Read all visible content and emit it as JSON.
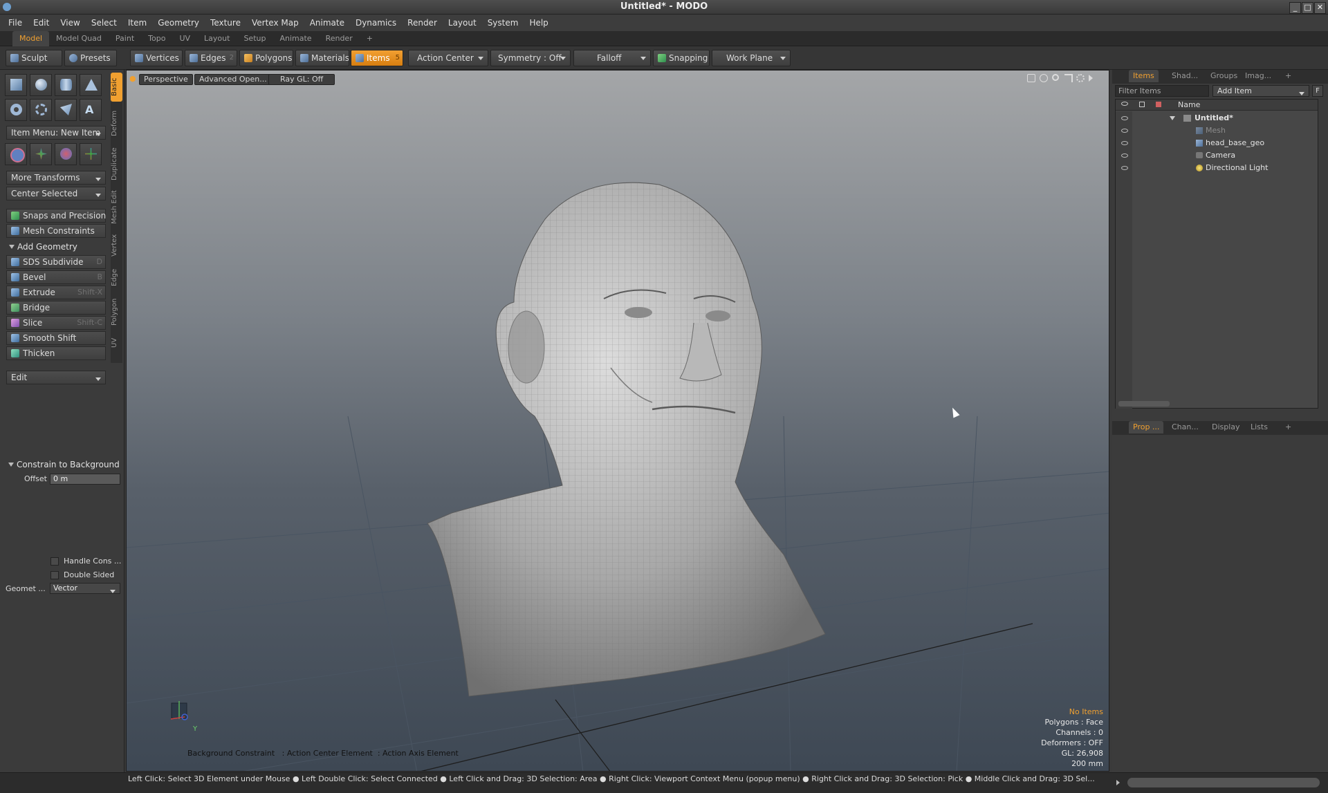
{
  "window": {
    "title": "Untitled* - MODO"
  },
  "menubar": {
    "items": [
      "File",
      "Edit",
      "View",
      "Select",
      "Item",
      "Geometry",
      "Texture",
      "Vertex Map",
      "Animate",
      "Dynamics",
      "Render",
      "Layout",
      "System",
      "Help"
    ]
  },
  "layout_tabs": {
    "items": [
      "Model",
      "Model Quad",
      "Paint",
      "Topo",
      "UV",
      "Layout",
      "Setup",
      "Animate",
      "Render"
    ],
    "active": "Model"
  },
  "toolbar": {
    "sculpt": "Sculpt",
    "presets": "Presets",
    "vertices": "Vertices",
    "edges": "Edges",
    "edges_count": "2",
    "polygons": "Polygons",
    "materials": "Materials",
    "items": "Items",
    "items_count": "5",
    "action_center": "Action Center",
    "symmetry": "Symmetry : Off",
    "falloff": "Falloff",
    "snapping": "Snapping",
    "work_plane": "Work Plane"
  },
  "left_panel": {
    "item_menu": "Item Menu: New Item",
    "more_transforms": "More Transforms",
    "center_selected": "Center Selected",
    "snaps": "Snaps and Precision",
    "mesh_constraints": "Mesh Constraints",
    "add_geometry": "Add Geometry",
    "tools": [
      {
        "label": "SDS Subdivide",
        "shortcut": "D"
      },
      {
        "label": "Bevel",
        "shortcut": "B"
      },
      {
        "label": "Extrude",
        "shortcut": "Shift-X"
      },
      {
        "label": "Bridge",
        "shortcut": ""
      },
      {
        "label": "Slice",
        "shortcut": "Shift-C"
      },
      {
        "label": "Smooth Shift",
        "shortcut": ""
      },
      {
        "label": "Thicken",
        "shortcut": ""
      }
    ],
    "edit_dropdown": "Edit",
    "vertical_tabs": [
      "Basic",
      "Deform",
      "Duplicate",
      "Mesh Edit",
      "Vertex",
      "Edge",
      "Polygon",
      "UV"
    ],
    "constrain": {
      "header": "Constrain to Background",
      "offset_label": "Offset",
      "offset_value": "0 m",
      "handle_cons": "Handle Cons ...",
      "double_sided": "Double Sided",
      "geometry_label": "Geomet ...",
      "geometry_value": "Vector"
    }
  },
  "viewport": {
    "perspective": "Perspective",
    "shading": "Advanced Open...",
    "raygl": "Ray GL: Off",
    "axis_y": "Y",
    "overlay_text": "Background Constraint   : Action Center Element  : Action Axis Element",
    "info": {
      "no_items": "No Items",
      "polygons": "Polygons : Face",
      "channels": "Channels : 0",
      "deformers": "Deformers : OFF",
      "gl": "GL: 26,908",
      "scale": "200 mm"
    }
  },
  "right_panel": {
    "top_tabs": [
      "Items",
      "Shad...",
      "Groups",
      "Imag..."
    ],
    "filter_placeholder": "Filter Items",
    "add_item": "Add Item",
    "f_button": "F",
    "name_header": "Name",
    "tree": [
      {
        "label": "Untitled*",
        "level": 0,
        "bold": true
      },
      {
        "label": "Mesh",
        "level": 1,
        "dim": true
      },
      {
        "label": "head_base_geo",
        "level": 1
      },
      {
        "label": "Camera",
        "level": 1
      },
      {
        "label": "Directional Light",
        "level": 1
      }
    ],
    "bottom_tabs": [
      "Prop ...",
      "Chan...",
      "Display",
      "Lists"
    ]
  },
  "status_bar": {
    "text": "Left Click: Select 3D Element under Mouse ● Left Double Click: Select Connected ● Left Click and Drag: 3D Selection: Area ● Right Click: Viewport Context Menu (popup menu) ● Right Click and Drag: 3D Selection: Pick ● Middle Click and Drag: 3D Sel..."
  },
  "colors": {
    "accent": "#f0a030",
    "panel": "#3b3b3b",
    "viewport_top": "#a4a6a8",
    "viewport_bottom": "#3e4854"
  }
}
